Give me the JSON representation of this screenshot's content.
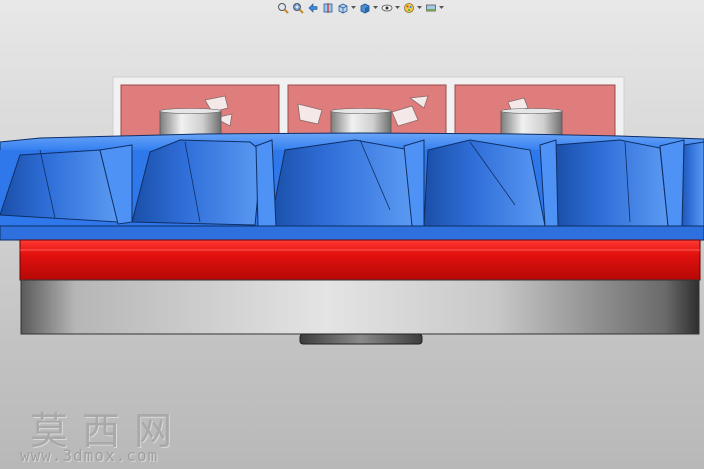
{
  "toolbar": {
    "buttons": [
      {
        "name": "zoom-to-fit-icon"
      },
      {
        "name": "zoom-to-area-icon"
      },
      {
        "name": "previous-view-icon"
      },
      {
        "name": "section-view-icon"
      },
      {
        "name": "view-orientation-icon"
      },
      {
        "name": "display-style-icon"
      },
      {
        "name": "hide-show-items-icon"
      },
      {
        "name": "edit-appearance-icon"
      },
      {
        "name": "apply-scene-icon"
      },
      {
        "name": "view-settings-icon"
      }
    ]
  },
  "model": {
    "colors": {
      "blue_body": "#2f7cf0",
      "red_band": "#e3120f",
      "grey_ring": "#b9b9b9",
      "pink_panel": "#df7c7c",
      "studs": "#cfcfcf"
    }
  },
  "watermark": {
    "main": "莫西网",
    "url": "www.3dmox.com"
  }
}
